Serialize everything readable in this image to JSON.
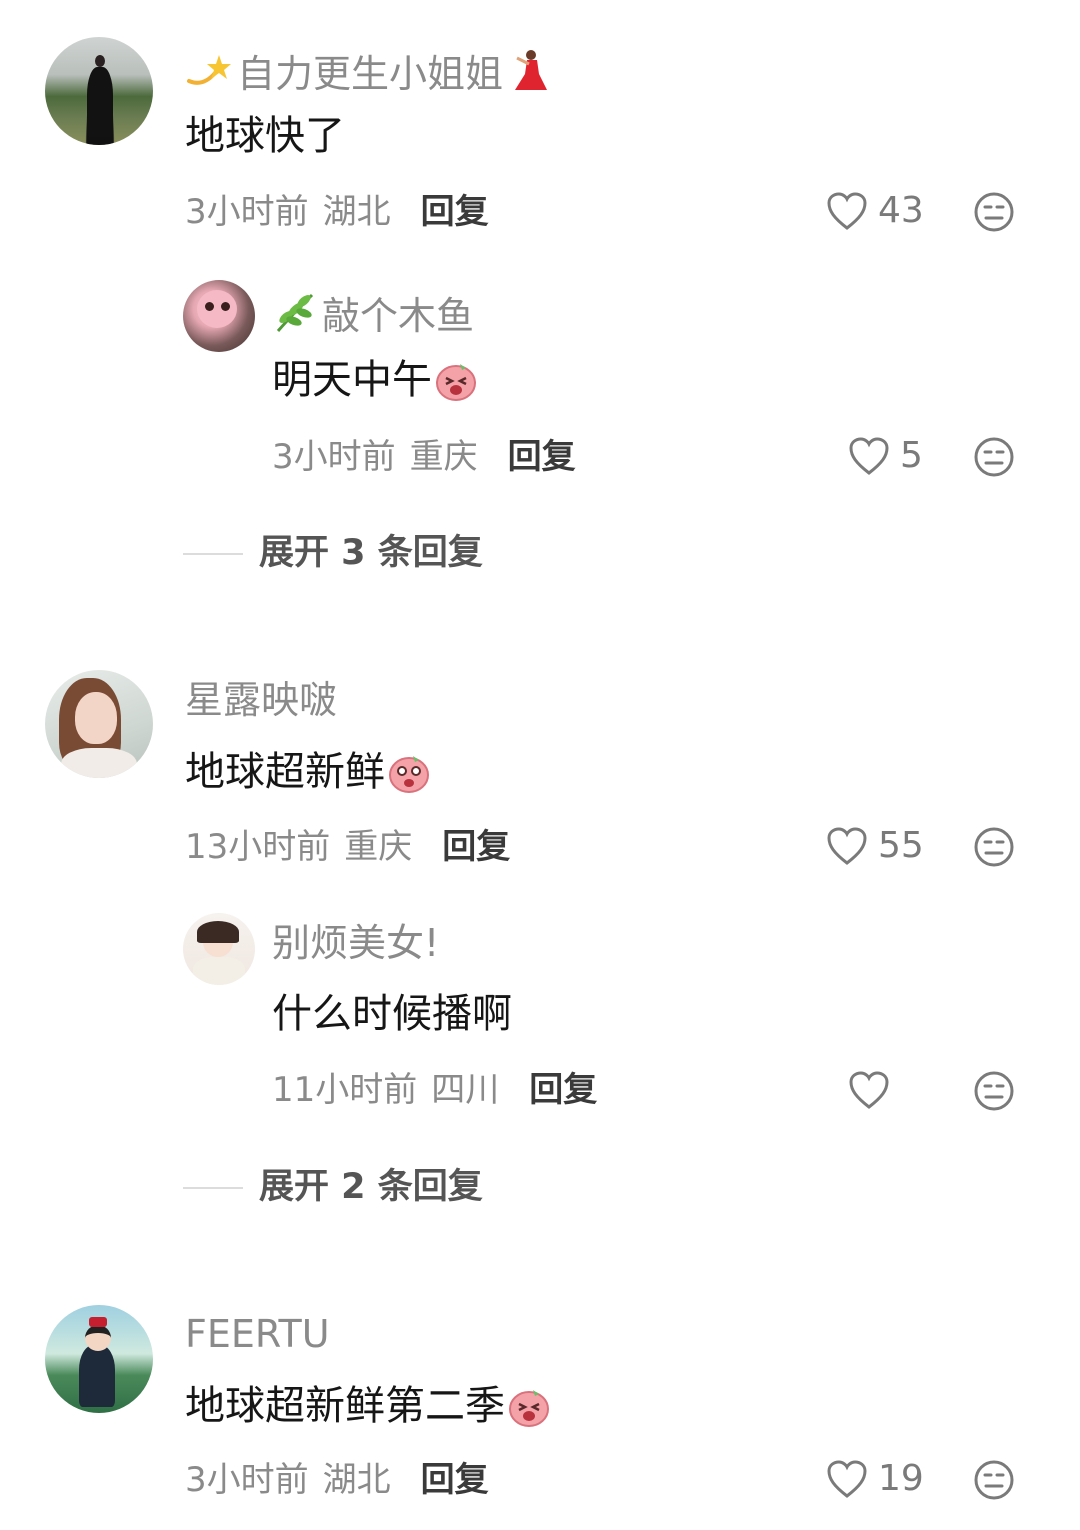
{
  "comments": [
    {
      "username": "自力更生小姐姐",
      "content": "地球快了",
      "time": "3小时前",
      "location": "湖北",
      "reply_label": "回复",
      "likes": "43",
      "replies": [
        {
          "username": "敲个木鱼",
          "content": "明天中午",
          "time": "3小时前",
          "location": "重庆",
          "reply_label": "回复",
          "likes": "5"
        }
      ],
      "expand_label": "展开 3 条回复"
    },
    {
      "username": "星露映啵",
      "content": "地球超新鲜",
      "time": "13小时前",
      "location": "重庆",
      "reply_label": "回复",
      "likes": "55",
      "replies": [
        {
          "username": "别烦美女!",
          "content": "什么时候播啊",
          "time": "11小时前",
          "location": "四川",
          "reply_label": "回复",
          "likes": ""
        }
      ],
      "expand_label": "展开 2 条回复"
    },
    {
      "username": "FEERTU",
      "content": "地球超新鲜第二季",
      "time": "3小时前",
      "location": "湖北",
      "reply_label": "回复",
      "likes": "19"
    }
  ],
  "icons": {
    "like": "heart-outline-icon",
    "dislike": "meh-face-icon",
    "sticker": "pink-blob-sticker"
  },
  "colors": {
    "username": "#8a8a8a",
    "content": "#161616",
    "meta": "#8a8a8a",
    "reply": "#3a3a3a",
    "icon": "#7a7a7a",
    "sticker": "#f4a1a8"
  }
}
